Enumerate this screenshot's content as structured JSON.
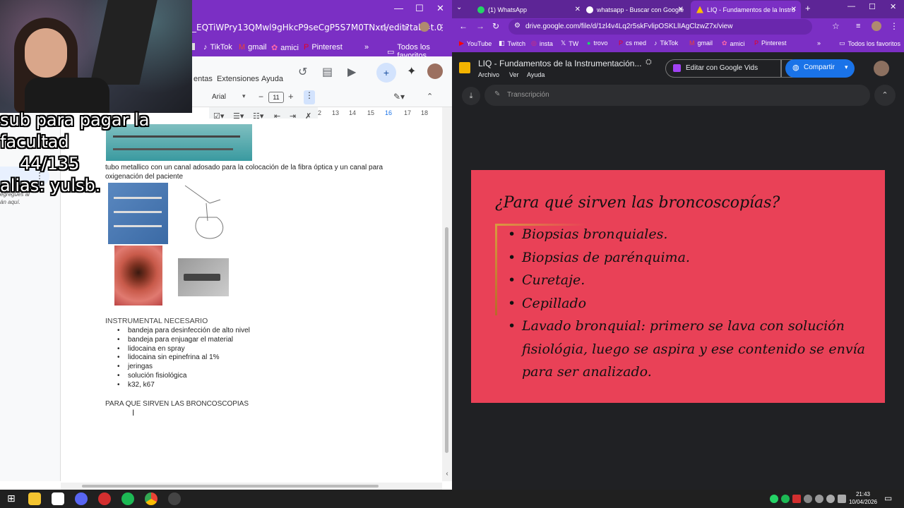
{
  "left_window": {
    "url": "_EQTiWPry13QMwl9gHkcP9seCgP5S7M0TNxrl/edit?tab=t.0",
    "bookmarks": [
      "TikTok",
      "gmail",
      "amici",
      "Pinterest"
    ],
    "all_bookmarks": "Todos los favoritos",
    "menu": [
      "entas",
      "Extensiones",
      "Ayuda"
    ],
    "font_name": "Arial",
    "font_size": "11",
    "ruler_ticks": [
      "2",
      "13",
      "14",
      "15",
      "16",
      "17",
      "18"
    ],
    "side_text": "egregues al\nán aquí.",
    "doc": {
      "paragraph1": "tubo metallico con un canal adosado para la colocación de la fibra óptica y un canal para",
      "paragraph1b": "oxigenación del paciente",
      "section_title": "INSTRUMENTAL NECESARIO",
      "items": [
        "bandeja para desinfección de alto nivel",
        "bandeja para enjuagar el material",
        "lidocaina en spray",
        "lidocaina sin epinefrina al 1%",
        "jeringas",
        "solución fisiológica",
        "k32, k67"
      ],
      "heading2": "PARA QUE SIRVEN LAS BRONCOSCOPIAS"
    }
  },
  "overlay": {
    "line1": "sub para pagar la facultad",
    "line2": "44/135",
    "line3": "alias: yulsb."
  },
  "right_window": {
    "tabs": [
      {
        "label": "(1) WhatsApp",
        "active": false
      },
      {
        "label": "whatsapp - Buscar con Google",
        "active": false
      },
      {
        "label": "LIQ - Fundamentos de la Instru",
        "active": true
      }
    ],
    "url": "drive.google.com/file/d/1zl4v4Lq2r5skFvlipOSKLlIAgClzwZ7x/view",
    "bookmarks": [
      "YouTube",
      "Twitch",
      "insta",
      "TW",
      "trovo",
      "cs med",
      "TikTok",
      "gmail",
      "amici",
      "Pinterest"
    ],
    "all_bookmarks": "Todos los favoritos",
    "file_title": "LIQ - Fundamentos de la Instrumentación...",
    "menu": [
      "Archivo",
      "Ver",
      "Ayuda"
    ],
    "edit_button": "Editar con Google Vids",
    "share_button": "Compartir",
    "transcript_label": "Transcripción",
    "slide": {
      "title": "¿Para qué sirven las broncoscopías?",
      "bullets": [
        "Biopsias bronquiales.",
        "Biopsias de parénquima.",
        "Curetaje.",
        "Cepillado",
        "Lavado bronquial: primero se lava con solución fisiológia, luego se aspira y ese contenido se envía para ser analizado."
      ],
      "background_color": "#e94157"
    }
  },
  "taskbar": {
    "time": "21:43",
    "date": "10/04/2026"
  }
}
